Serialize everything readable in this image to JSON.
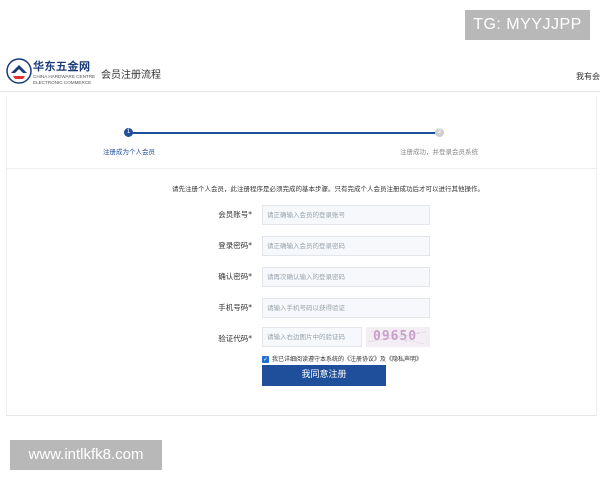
{
  "watermarks": {
    "top": "TG: MYYJJPP",
    "bottom": "www.intlkfk8.com"
  },
  "header": {
    "logo_cn": "华东五金网",
    "logo_en_line1": "CHINA HARDWARE CENTRE",
    "logo_en_line2": "ELECTRONIC COMMERCE",
    "title": "会员注册流程",
    "right_text": "我有会"
  },
  "steps": [
    {
      "number": "1",
      "label": "注册成为个人会员",
      "active": true
    },
    {
      "number": "2",
      "label": "注册成功，并登录会员系统",
      "active": false
    }
  ],
  "intro": "请先注册个人会员，此注册程序是必须完成的基本步骤。只有完成个人会员注册成功后才可以进行其他操作。",
  "form": {
    "account": {
      "label": "会员账号*",
      "placeholder": "请正确输入会员的登录账号"
    },
    "password": {
      "label": "登录密码*",
      "placeholder": "请正确输入会员的登录密码"
    },
    "confirm": {
      "label": "确认密码*",
      "placeholder": "请再次确认输入的登录密码"
    },
    "phone": {
      "label": "手机号码*",
      "placeholder": "请输入手机号码以获得验证"
    },
    "captcha": {
      "label": "验证代码*",
      "placeholder": "请输入右边图片中的验证码",
      "code": "09650"
    }
  },
  "agreement": {
    "prefix": "我已详细阅读遵守本系统的",
    "terms": "《注册协议》",
    "and": "及",
    "privacy": "《隐私声明》",
    "checked": true
  },
  "submit_label": "我同意注册",
  "colors": {
    "accent": "#1f4e9b",
    "checkbox": "#1f6fd6"
  }
}
